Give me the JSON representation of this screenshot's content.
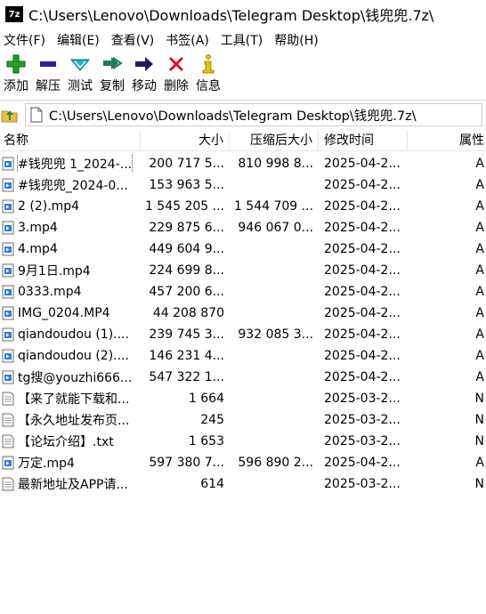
{
  "window": {
    "app_icon_text": "7z",
    "title": "C:\\Users\\Lenovo\\Downloads\\Telegram Desktop\\钱兜兜.7z\\"
  },
  "menu": [
    "文件(F)",
    "编辑(E)",
    "查看(V)",
    "书签(A)",
    "工具(T)",
    "帮助(H)"
  ],
  "toolbar": {
    "add": "添加",
    "extract": "解压",
    "test": "测试",
    "copy": "复制",
    "move": "移动",
    "delete": "删除",
    "info": "信息"
  },
  "address": {
    "value": "C:\\Users\\Lenovo\\Downloads\\Telegram Desktop\\钱兜兜.7z\\"
  },
  "columns": {
    "name": "名称",
    "size": "大小",
    "packed": "压缩后大小",
    "modified": "修改时间",
    "attributes": "属性"
  },
  "files": [
    {
      "name": "#钱兜兜 1_2024-...",
      "size": "200 717 5...",
      "packed": "810 998 8...",
      "modified": "2025-04-2...",
      "attr": "A",
      "type": "video",
      "selected": true
    },
    {
      "name": "#钱兜兜_2024-0...",
      "size": "153 963 5...",
      "packed": "",
      "modified": "2025-04-2...",
      "attr": "A",
      "type": "video"
    },
    {
      "name": "2 (2).mp4",
      "size": "1 545 205 ...",
      "packed": "1 544 709 ...",
      "modified": "2025-04-2...",
      "attr": "A",
      "type": "video"
    },
    {
      "name": "3.mp4",
      "size": "229 875 6...",
      "packed": "946 067 0...",
      "modified": "2025-04-2...",
      "attr": "A",
      "type": "video"
    },
    {
      "name": "4.mp4",
      "size": "449 604 9...",
      "packed": "",
      "modified": "2025-04-2...",
      "attr": "A",
      "type": "video"
    },
    {
      "name": "9月1日.mp4",
      "size": "224 699 8...",
      "packed": "",
      "modified": "2025-04-2...",
      "attr": "A",
      "type": "video"
    },
    {
      "name": "0333.mp4",
      "size": "457 200 6...",
      "packed": "",
      "modified": "2025-04-2...",
      "attr": "A",
      "type": "video"
    },
    {
      "name": "IMG_0204.MP4",
      "size": "44 208 870",
      "packed": "",
      "modified": "2025-04-2...",
      "attr": "A",
      "type": "video"
    },
    {
      "name": "qiandoudou (1)....",
      "size": "239 745 3...",
      "packed": "932 085 3...",
      "modified": "2025-04-2...",
      "attr": "A",
      "type": "video"
    },
    {
      "name": "qiandoudou (2)....",
      "size": "146 231 4...",
      "packed": "",
      "modified": "2025-04-2...",
      "attr": "A",
      "type": "video"
    },
    {
      "name": "tg搜@youzhi666...",
      "size": "547 322 1...",
      "packed": "",
      "modified": "2025-04-2...",
      "attr": "A",
      "type": "video"
    },
    {
      "name": "【来了就能下载和...",
      "size": "1 664",
      "packed": "",
      "modified": "2025-03-2...",
      "attr": "N",
      "type": "text"
    },
    {
      "name": "【永久地址发布页...",
      "size": "245",
      "packed": "",
      "modified": "2025-03-2...",
      "attr": "N",
      "type": "text"
    },
    {
      "name": "【论坛介绍】.txt",
      "size": "1 653",
      "packed": "",
      "modified": "2025-03-2...",
      "attr": "N",
      "type": "text"
    },
    {
      "name": "万定.mp4",
      "size": "597 380 7...",
      "packed": "596 890 2...",
      "modified": "2025-04-2...",
      "attr": "A",
      "type": "video"
    },
    {
      "name": "最新地址及APP请...",
      "size": "614",
      "packed": "",
      "modified": "2025-03-2...",
      "attr": "N",
      "type": "text"
    }
  ],
  "icons": {
    "add": "plus-icon",
    "extract": "minus-icon",
    "test": "check-arrow-icon",
    "copy": "double-arrow-icon",
    "move": "arrow-right-icon",
    "delete": "x-icon",
    "info": "info-icon",
    "up": "folder-up-icon",
    "video_file": "video-file-icon",
    "text_file": "text-file-icon"
  },
  "colors": {
    "add": "#1aa51a",
    "extract": "#2323a8",
    "test": "#1fb5c4",
    "copy": "#1e7a66",
    "move": "#1b1b6b",
    "delete": "#e01010",
    "info": "#e6c200"
  }
}
